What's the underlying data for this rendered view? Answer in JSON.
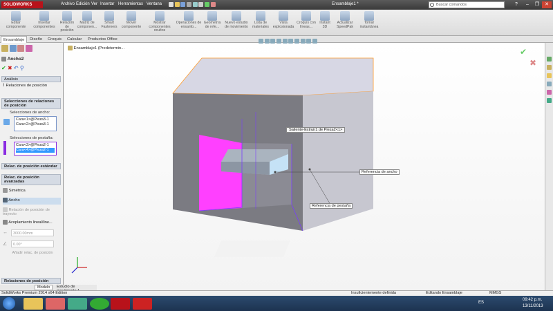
{
  "titlebar": {
    "brand": "SOLIDWORKS",
    "menus": [
      "Archivo",
      "Edición",
      "Ver",
      "Insertar",
      "Herramientas",
      "Ventana"
    ],
    "doc_title": "Ensamblaje1 *",
    "search_placeholder": "Buscar comandos",
    "help": "?",
    "minimize": "–",
    "restore": "❐",
    "close": "✕"
  },
  "ribbon": {
    "buttons": [
      {
        "label": "Editar componente"
      },
      {
        "label": "Insertar componentes"
      },
      {
        "label": "Relación de posición"
      },
      {
        "label": "Matriz de componen..."
      },
      {
        "label": "Smart Fasteners"
      },
      {
        "label": "Mover componente"
      },
      {
        "label": "Mostrar componentes ocultos"
      },
      {
        "label": "Operaciones de ensamb..."
      },
      {
        "label": "Geometría de refe..."
      },
      {
        "label": "Nuevo estudio de movimiento"
      },
      {
        "label": "Lista de materiales"
      },
      {
        "label": "Vista explosionada"
      },
      {
        "label": "Croquis con líneas..."
      },
      {
        "label": "Instant 3D"
      },
      {
        "label": "Actualizar SpeedPak"
      },
      {
        "label": "Tomar instantánea"
      }
    ]
  },
  "tabs": [
    "Ensamblaje",
    "Diseño",
    "Croquis",
    "Calcular",
    "Productos Office"
  ],
  "panel": {
    "feature_title": "Ancho2",
    "analysis_tab": "Análisis",
    "mates_tab": "Relaciones de posición",
    "selections_header": "Selecciones de relaciones de posición",
    "width_label": "Selecciones de ancho:",
    "width_items": [
      "Cara<1>@Pieza3-1",
      "Cara<2>@Pieza3-1"
    ],
    "tab_label": "Selecciones de pestaña:",
    "tab_items": [
      "Cara<3>@Pieza2-1",
      "Cara<4>@Pieza2-1"
    ],
    "standard_header": "Relac. de posición estándar",
    "advanced_header": "Relac. de posición avanzadas",
    "advanced_items": [
      "Simétrica",
      "Ancho",
      "Relación de posición de trayecto",
      "Acoplamiento lineal/line..."
    ],
    "distance_value": "3000.00mm",
    "angle_value": "0.00°",
    "add_to_folder": "Añadir relac. de posición",
    "mates_footer": "Relaciones de posición"
  },
  "viewport": {
    "tree_label": "Ensamblaje1  (Predetermin..."
  },
  "annotations": {
    "part_label": "Saliente-Extruir1 de Pieza2<1>",
    "width_ref": "Referencia de ancho",
    "tab_ref": "Referencia de pestaña"
  },
  "bottom_tabs": [
    "Modelo",
    "Estudio de movimiento 1"
  ],
  "status": {
    "edition": "SolidWorks Premium 2014 x64 Edition",
    "definition": "Insuficientemente definida",
    "mode": "Editando Ensamblaje",
    "units": "MMGS"
  },
  "taskbar": {
    "lang": "ES",
    "time": "09:42 p.m.",
    "date": "13/11/2013"
  },
  "colors": {
    "brand_red": "#b8121a",
    "face_magenta": "#ff40ff",
    "select_blue": "#3399ff",
    "edge_purple": "#7a3cff",
    "edge_orange": "#ff9a2a"
  }
}
